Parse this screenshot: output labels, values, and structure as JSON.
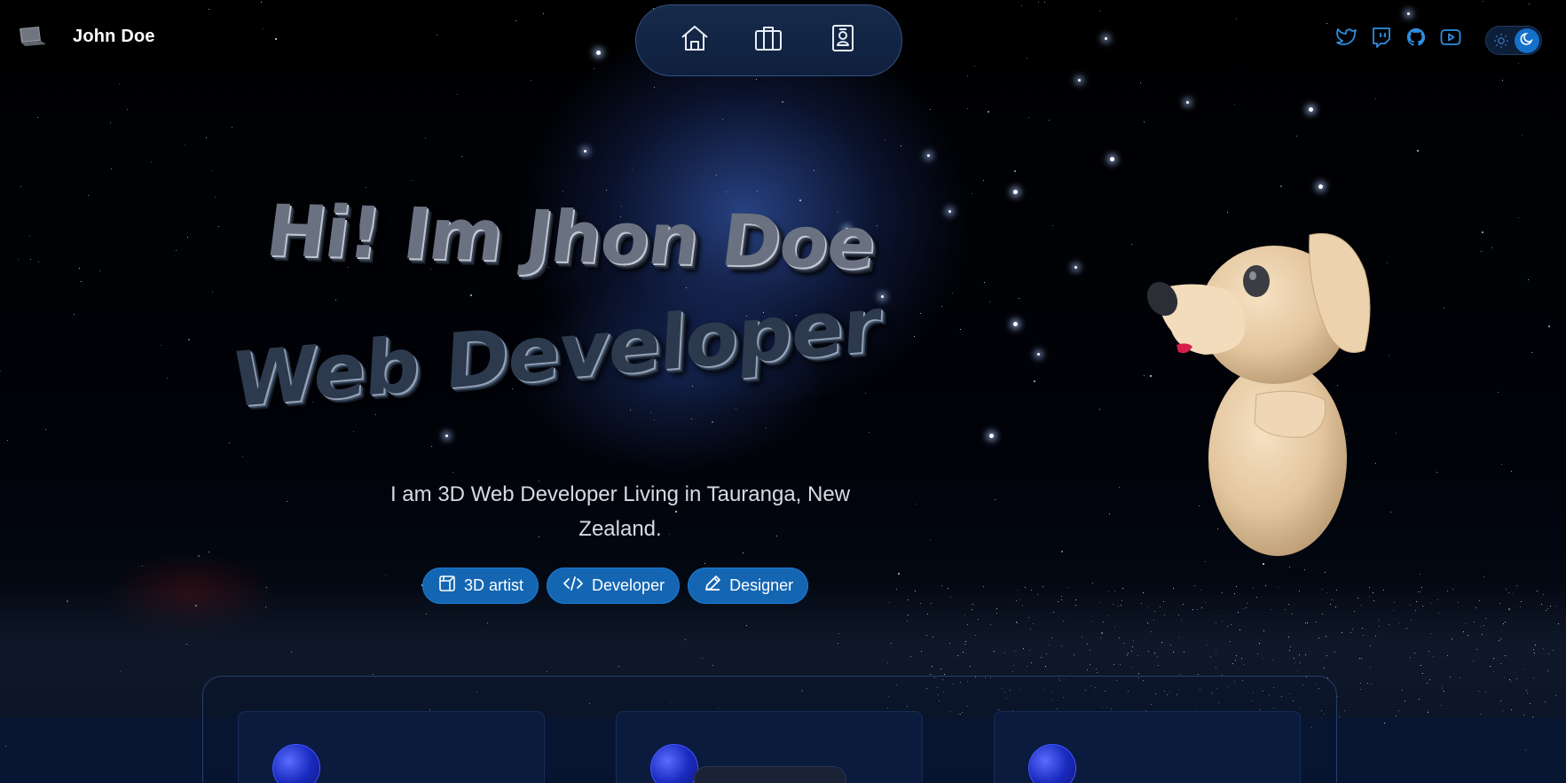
{
  "header": {
    "site_name": "John Doe",
    "logo_icon": "laptop-icon"
  },
  "nav": {
    "items": [
      {
        "icon": "home-icon",
        "label": "Home"
      },
      {
        "icon": "briefcase-icon",
        "label": "Work"
      },
      {
        "icon": "contact-card-icon",
        "label": "About"
      }
    ]
  },
  "social": {
    "links": [
      {
        "icon": "twitter-icon"
      },
      {
        "icon": "twitch-icon"
      },
      {
        "icon": "github-icon"
      },
      {
        "icon": "youtube-icon"
      }
    ]
  },
  "theme": {
    "mode": "dark",
    "light_icon": "sun-icon",
    "dark_icon": "moon-icon"
  },
  "hero": {
    "title_line1": "Hi! Im Jhon Doe",
    "title_line2": "Web Developer",
    "intro": "I am 3D Web Developer Living in Tauranga, New Zealand.",
    "tags": [
      {
        "label": "3D artist",
        "icon": "cube-icon"
      },
      {
        "label": "Developer",
        "icon": "code-icon"
      },
      {
        "label": "Designer",
        "icon": "pencil-icon"
      }
    ]
  },
  "colors": {
    "accent": "#1466b3",
    "nav_bg": "#172a4b",
    "social_icon": "#2f8fe0",
    "card_bg": "#0b1b3d"
  }
}
